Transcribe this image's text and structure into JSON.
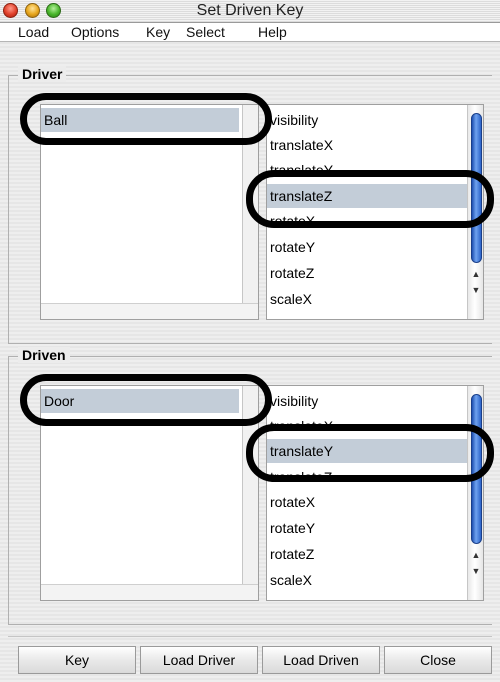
{
  "window": {
    "title": "Set Driven Key"
  },
  "menu": [
    "Load",
    "Options",
    "Key",
    "Select",
    "Help"
  ],
  "driver": {
    "group_label": "Driver",
    "objects": [
      "Ball"
    ],
    "selected_object": "Ball",
    "attributes": [
      "visibility",
      "translateX",
      "translateY",
      "translateZ",
      "rotateX",
      "rotateY",
      "rotateZ",
      "scaleX"
    ],
    "selected_attribute": "translateZ"
  },
  "driven": {
    "group_label": "Driven",
    "objects": [
      "Door"
    ],
    "selected_object": "Door",
    "attributes": [
      "visibility",
      "translateX",
      "translateY",
      "translateZ",
      "rotateX",
      "rotateY",
      "rotateZ",
      "scaleX"
    ],
    "selected_attribute": "translateY"
  },
  "buttons": {
    "key": "Key",
    "load_driver": "Load Driver",
    "load_driven": "Load Driven",
    "close": "Close"
  },
  "colors": {
    "selection": "#c3cdd8",
    "scroll_thumb": "#2c63c9",
    "annotation_ring": "#000000"
  }
}
